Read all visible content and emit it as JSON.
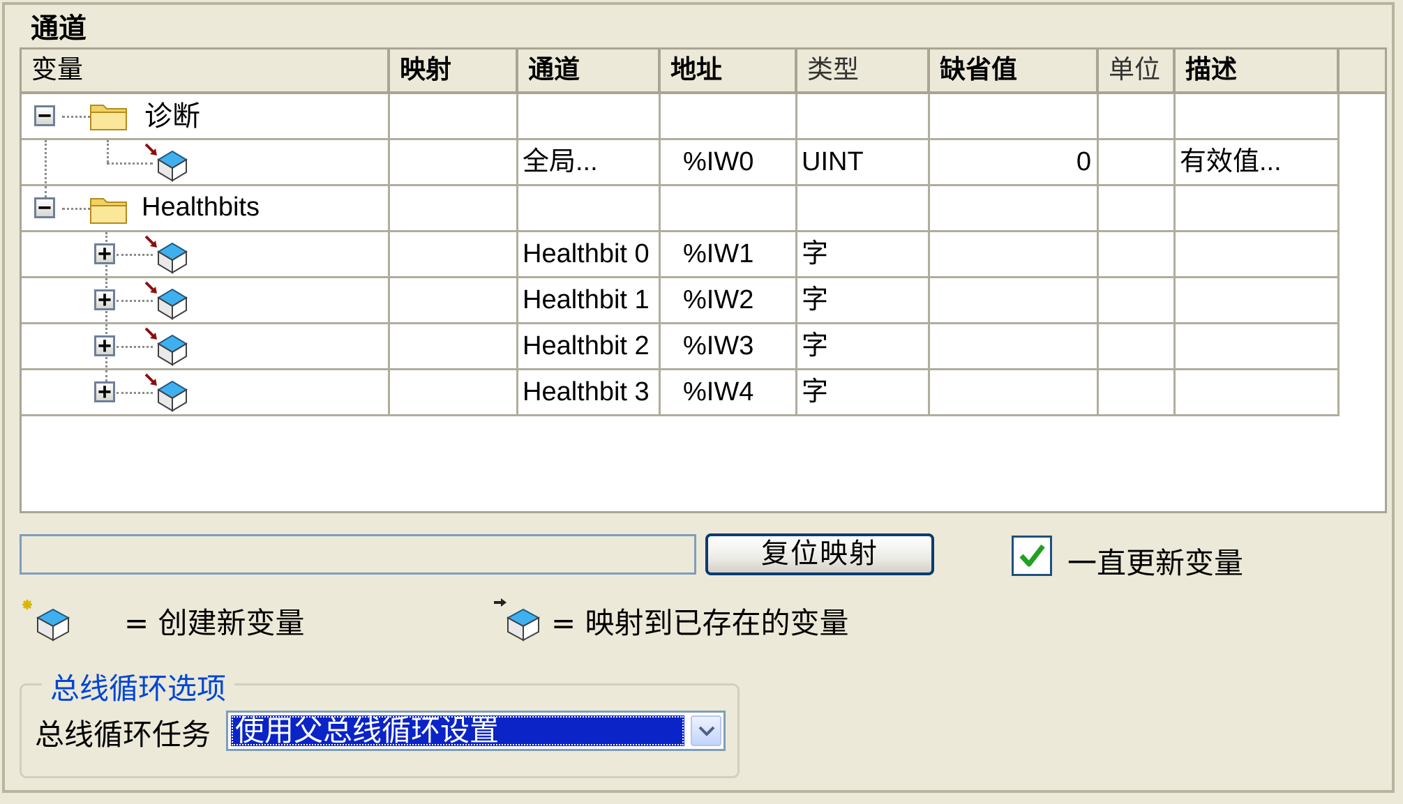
{
  "section_title": "通道",
  "columns": {
    "variable": "变量",
    "mapping": "映射",
    "channel": "通道",
    "address": "地址",
    "type": "类型",
    "default": "缺省值",
    "unit": "单位",
    "description": "描述"
  },
  "tree": {
    "diag": {
      "label": "诊断",
      "expander": "−"
    },
    "diag_child": {
      "channel": "全局...",
      "address": "%IW0",
      "type": "UINT",
      "default": "0",
      "description": "有效值..."
    },
    "health": {
      "label": "Healthbits",
      "expander": "−"
    },
    "health_children": [
      {
        "expander": "+",
        "channel": "Healthbit 0",
        "address": "%IW1",
        "type": "字"
      },
      {
        "expander": "+",
        "channel": "Healthbit 1",
        "address": "%IW2",
        "type": "字"
      },
      {
        "expander": "+",
        "channel": "Healthbit 2",
        "address": "%IW3",
        "type": "字"
      },
      {
        "expander": "+",
        "channel": "Healthbit 3",
        "address": "%IW4",
        "type": "字"
      }
    ]
  },
  "controls": {
    "filter_value": "",
    "reset_button": "复位映射",
    "always_update_label": "一直更新变量",
    "always_update_checked": true
  },
  "legend": {
    "create_new": "= 创建新变量",
    "map_existing": "= 映射到已存在的变量"
  },
  "bus_cycle": {
    "group_title": "总线循环选项",
    "task_label": "总线循环任务",
    "task_value": "使用父总线循环设置"
  },
  "colors": {
    "select_highlight": "#0a24c8",
    "check": "#21a121",
    "group_title": "#0046d5"
  }
}
